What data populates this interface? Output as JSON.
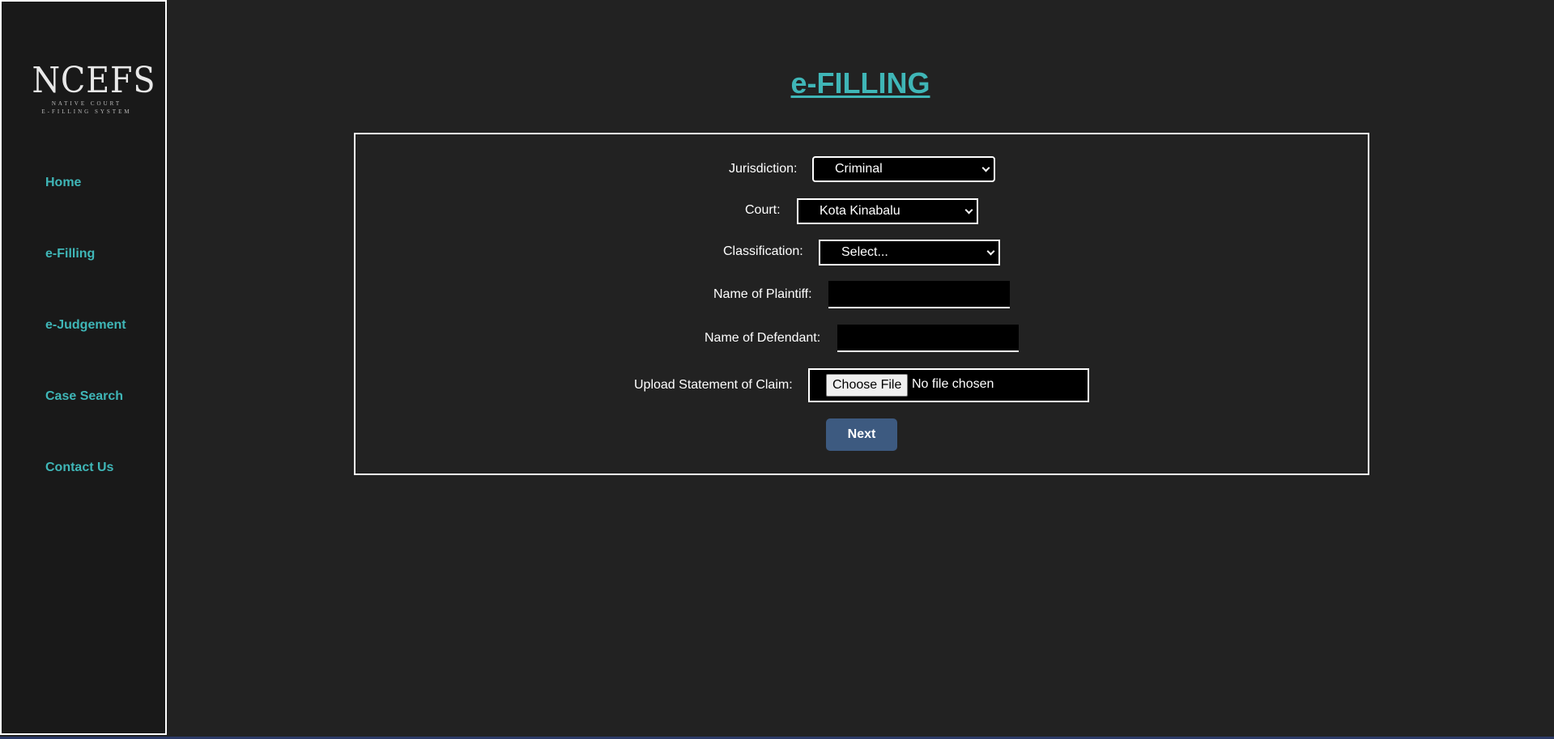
{
  "sidebar": {
    "logo": {
      "main": "NCEFS",
      "sub_line1": "NATIVE COURT",
      "sub_line2": "E-FILLING SYSTEM"
    },
    "items": [
      {
        "label": "Home"
      },
      {
        "label": "e-Filling"
      },
      {
        "label": "e-Judgement"
      },
      {
        "label": "Case Search"
      },
      {
        "label": "Contact Us"
      }
    ]
  },
  "page": {
    "title": "e-FILLING"
  },
  "form": {
    "jurisdiction": {
      "label": "Jurisdiction:",
      "value": "Criminal"
    },
    "court": {
      "label": "Court:",
      "value": "Kota Kinabalu"
    },
    "classification": {
      "label": "Classification:",
      "value": "Select..."
    },
    "plaintiff": {
      "label": "Name of Plaintiff:",
      "value": ""
    },
    "defendant": {
      "label": "Name of Defendant:",
      "value": ""
    },
    "upload": {
      "label": "Upload Statement of Claim:",
      "button_label": "Choose File",
      "status": "No file chosen"
    },
    "next_label": "Next"
  },
  "colors": {
    "accent": "#3fb6b7",
    "background": "#222222",
    "sidebar_bg": "#191919",
    "button_bg": "#3d5a80",
    "field_bg": "#000000"
  }
}
